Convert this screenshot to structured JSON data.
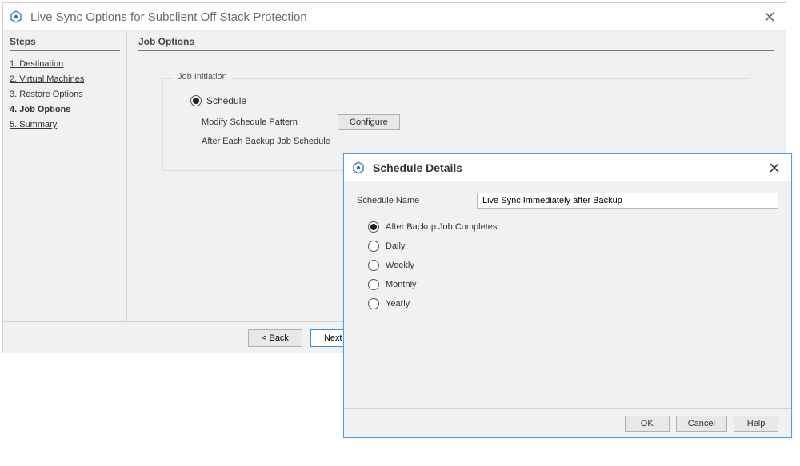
{
  "mainWindow": {
    "title": "Live Sync Options for Subclient Off Stack Protection",
    "steps": {
      "header": "Steps",
      "items": [
        {
          "label": "1. Destination",
          "current": false
        },
        {
          "label": "2. Virtual Machines",
          "current": false
        },
        {
          "label": "3. Restore Options",
          "current": false
        },
        {
          "label": "4. Job Options",
          "current": true
        },
        {
          "label": "5. Summary",
          "current": false
        }
      ]
    },
    "content": {
      "header": "Job Options",
      "jobInitiation": {
        "groupLabel": "Job Initiation",
        "scheduleRadio": {
          "label": "Schedule",
          "selected": true
        },
        "modifyPatternLabel": "Modify Schedule Pattern",
        "configureButton": "Configure",
        "afterEachText": "After Each Backup Job Schedule"
      }
    },
    "footer": {
      "backButton": "< Back",
      "nextButton": "Next >"
    }
  },
  "scheduleDialog": {
    "title": "Schedule Details",
    "nameLabel": "Schedule Name",
    "nameValue": "Live Sync Immediately after Backup",
    "options": [
      {
        "label": "After Backup Job Completes",
        "selected": true
      },
      {
        "label": "Daily",
        "selected": false
      },
      {
        "label": "Weekly",
        "selected": false
      },
      {
        "label": "Monthly",
        "selected": false
      },
      {
        "label": "Yearly",
        "selected": false
      }
    ],
    "buttons": {
      "ok": "OK",
      "cancel": "Cancel",
      "help": "Help"
    }
  }
}
